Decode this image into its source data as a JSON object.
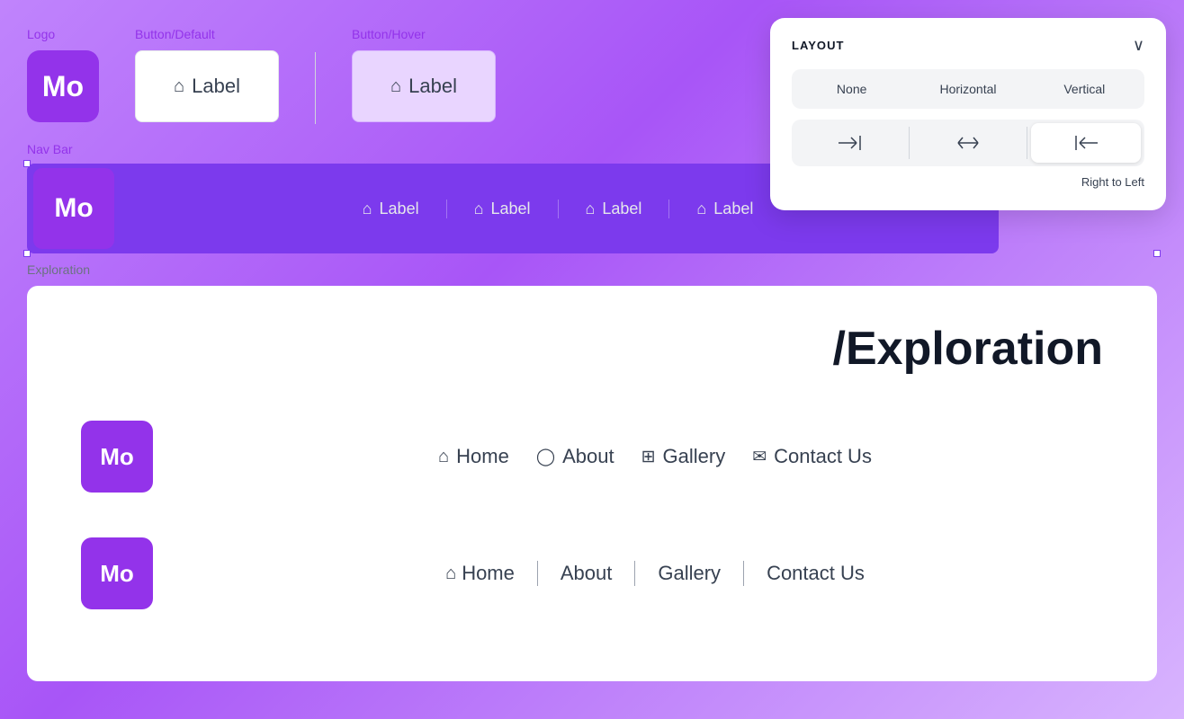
{
  "logo": {
    "text": "Mo"
  },
  "components": {
    "logo_label": "Logo",
    "button_default_label": "Button/Default",
    "button_hover_label": "Button/Hover",
    "btn_icon": "⌂",
    "btn_text": "Label"
  },
  "navbar": {
    "label": "Nav Bar",
    "logo_text": "Mo",
    "items": [
      {
        "icon": "⌂",
        "label": "Label"
      },
      {
        "icon": "⌂",
        "label": "Label"
      },
      {
        "icon": "⌂",
        "label": "Label"
      },
      {
        "icon": "⌂",
        "label": "Label"
      }
    ]
  },
  "exploration": {
    "section_label": "Exploration",
    "title": "/Exploration",
    "row1": {
      "logo_text": "Mo",
      "items": [
        {
          "icon": "home",
          "label": "Home"
        },
        {
          "icon": "user",
          "label": "About"
        },
        {
          "icon": "gallery",
          "label": "Gallery"
        },
        {
          "icon": "mail",
          "label": "Contact Us"
        }
      ]
    },
    "row2": {
      "logo_text": "Mo",
      "items": [
        {
          "icon": "home",
          "label": "Home"
        },
        {
          "label": "About"
        },
        {
          "label": "Gallery"
        },
        {
          "label": "Contact Us"
        }
      ]
    }
  },
  "layout_panel": {
    "title": "LAYOUT",
    "options": [
      {
        "label": "None",
        "active": false
      },
      {
        "label": "Horizontal",
        "active": false
      },
      {
        "label": "Vertical",
        "active": false
      }
    ],
    "directions": [
      {
        "symbol": "→|",
        "active": false
      },
      {
        "symbol": "↔",
        "active": false
      },
      {
        "symbol": "|←",
        "active": true
      }
    ],
    "direction_label": "Right to Left"
  }
}
